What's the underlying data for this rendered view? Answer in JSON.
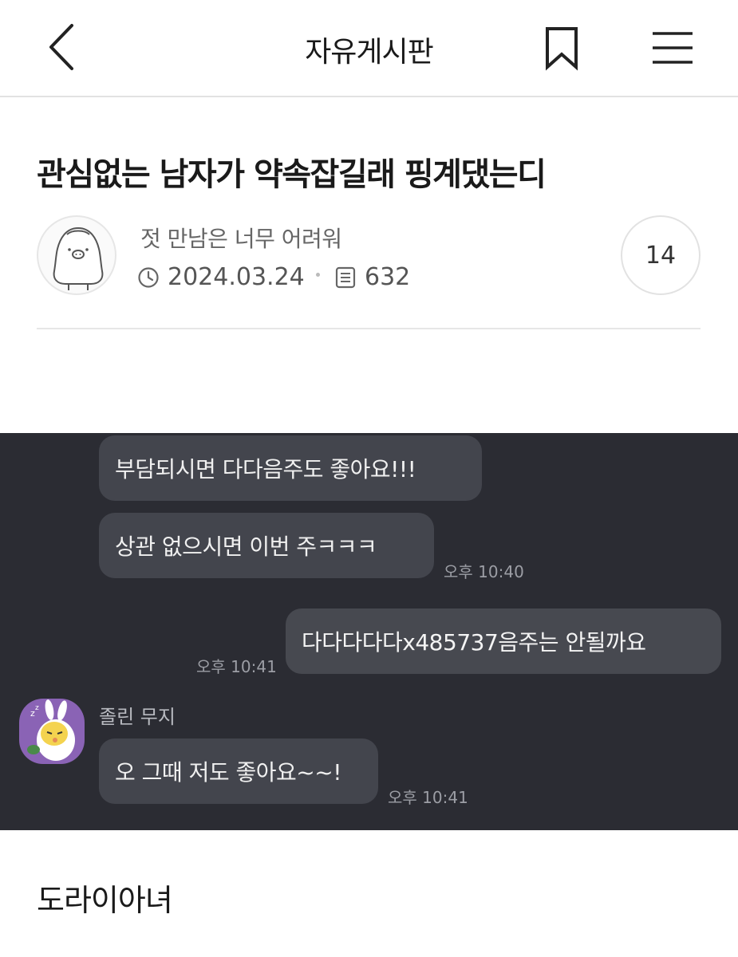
{
  "header": {
    "title": "자유게시판",
    "back_icon": "back-chevron-icon",
    "bookmark_icon": "bookmark-icon",
    "menu_icon": "hamburger-menu-icon"
  },
  "post": {
    "title": "관심없는 남자가 약속잡길래 핑계댔는디",
    "author": "젓 만남은 너무 어려워",
    "date": "2024.03.24",
    "views": "632",
    "comment_count": "14",
    "body": "도라이아녀"
  },
  "chat": {
    "messages": [
      {
        "text": "부담되시면 다다음주도 좋아요!!!"
      },
      {
        "text": "상관 없으시면 이번 주ㅋㅋㅋ",
        "time": "오후 10:40"
      },
      {
        "text": "다다다다다x485737음주는 안될까요",
        "time": "오후 10:41"
      },
      {
        "text": "오 그때 저도 좋아요~~!",
        "time": "오후 10:41"
      }
    ],
    "sender_name": "졸린 무지"
  },
  "colors": {
    "chat_background": "#2b2c33",
    "bubble": "#43454d",
    "text_primary": "#1a1a1a",
    "text_meta": "#555555",
    "divider": "#e6e6e6"
  }
}
